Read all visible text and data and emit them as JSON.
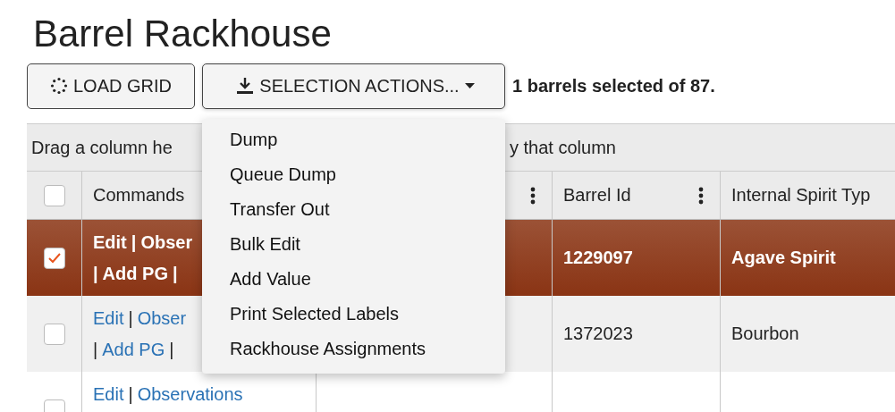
{
  "title": "Barrel Rackhouse",
  "toolbar": {
    "load_button": "LOAD GRID",
    "actions_button": "SELECTION ACTIONS...",
    "selection_status": "1 barrels selected of 87."
  },
  "actions_menu": {
    "expanded": true,
    "items": [
      "Dump",
      "Queue Dump",
      "Transfer Out",
      "Bulk Edit",
      "Add Value",
      "Print Selected Labels",
      "Rackhouse Assignments"
    ]
  },
  "group_bar": {
    "text_left": "Drag a column he",
    "text_right": "y that column"
  },
  "columns": [
    {
      "kind": "check",
      "checked": false
    },
    {
      "kind": "text",
      "label": "Commands"
    },
    {
      "kind": "menu"
    },
    {
      "kind": "text",
      "label": "Barrel Id",
      "menu": true
    },
    {
      "kind": "text",
      "label": "Internal Spirit Typ"
    }
  ],
  "rows": [
    {
      "selected": true,
      "commands": [
        [
          {
            "kind": "link",
            "text": "Edit"
          },
          {
            "kind": "sep",
            "text": "|"
          },
          {
            "kind": "link",
            "text": "Obser"
          }
        ],
        [
          {
            "kind": "sep",
            "text": "|"
          },
          {
            "kind": "link",
            "text": "Add PG"
          },
          {
            "kind": "sep",
            "text": "|"
          }
        ]
      ],
      "barrel_id": "1229097",
      "spirit_type": "Agave Spirit"
    },
    {
      "selected": false,
      "commands": [
        [
          {
            "kind": "link",
            "text": "Edit"
          },
          {
            "kind": "sep",
            "text": "|"
          },
          {
            "kind": "link",
            "text": "Obser"
          }
        ],
        [
          {
            "kind": "sep",
            "text": "|"
          },
          {
            "kind": "link",
            "text": "Add PG"
          },
          {
            "kind": "sep",
            "text": "|"
          }
        ]
      ],
      "barrel_id": "1372023",
      "spirit_type": "Bourbon"
    },
    {
      "selected": false,
      "commands": [
        [
          {
            "kind": "link",
            "text": "Edit"
          },
          {
            "kind": "sep",
            "text": "|"
          },
          {
            "kind": "link",
            "text": "Observations"
          }
        ]
      ]
    }
  ]
}
